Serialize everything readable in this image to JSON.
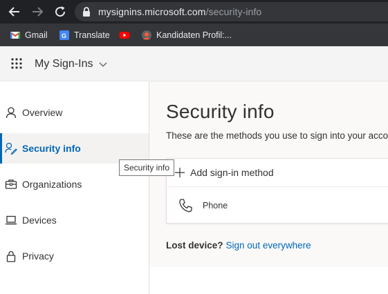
{
  "browser": {
    "url_domain": "mysignins.microsoft.com",
    "url_path": "/security-info",
    "bookmarks": [
      {
        "label": "Gmail",
        "icon": "gmail-icon"
      },
      {
        "label": "Translate",
        "icon": "google-translate-icon"
      },
      {
        "label": "",
        "icon": "youtube-icon"
      },
      {
        "label": "Kandidaten Profil:...",
        "icon": "profile-favicon-icon"
      }
    ]
  },
  "header": {
    "app_title": "My Sign-Ins"
  },
  "sidebar": {
    "items": [
      {
        "label": "Overview",
        "icon": "person-icon",
        "active": false
      },
      {
        "label": "Security info",
        "icon": "security-info-icon",
        "active": true
      },
      {
        "label": "Organizations",
        "icon": "briefcase-icon",
        "active": false
      },
      {
        "label": "Devices",
        "icon": "laptop-icon",
        "active": false
      },
      {
        "label": "Privacy",
        "icon": "lock-icon",
        "active": false
      }
    ],
    "tooltip": "Security info"
  },
  "main": {
    "title": "Security info",
    "subtitle": "These are the methods you use to sign into your acco",
    "add_method_label": "Add sign-in method",
    "methods": [
      {
        "label": "Phone",
        "icon": "phone-icon"
      }
    ],
    "lost_device_label": "Lost device?",
    "signout_link": "Sign out everywhere"
  },
  "colors": {
    "accent": "#0067b8",
    "chrome_dark": "#202124",
    "bookmark_bar": "#35363a",
    "header_bg": "#f4f4f4",
    "panel_bg": "#faf9f8"
  }
}
